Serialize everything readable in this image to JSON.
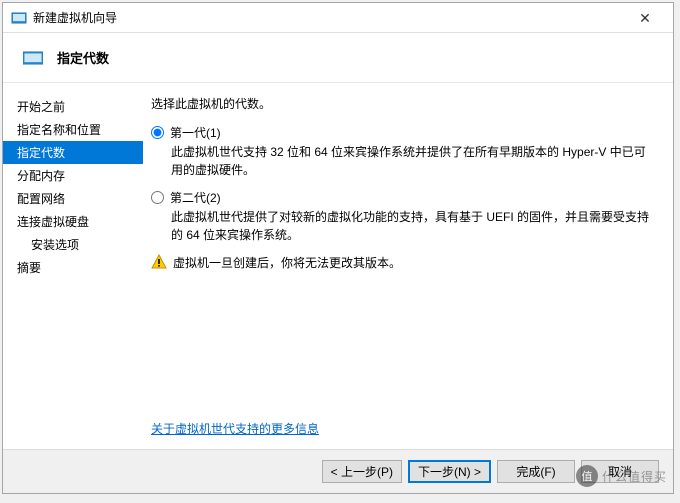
{
  "window": {
    "title": "新建虚拟机向导"
  },
  "header": {
    "title": "指定代数"
  },
  "sidebar": {
    "items": [
      {
        "label": "开始之前"
      },
      {
        "label": "指定名称和位置"
      },
      {
        "label": "指定代数"
      },
      {
        "label": "分配内存"
      },
      {
        "label": "配置网络"
      },
      {
        "label": "连接虚拟硬盘"
      },
      {
        "label": "安装选项"
      },
      {
        "label": "摘要"
      }
    ]
  },
  "content": {
    "description": "选择此虚拟机的代数。",
    "option1": {
      "label": "第一代(1)",
      "desc": "此虚拟机世代支持 32 位和 64 位来宾操作系统并提供了在所有早期版本的 Hyper-V 中已可用的虚拟硬件。"
    },
    "option2": {
      "label": "第二代(2)",
      "desc": "此虚拟机世代提供了对较新的虚拟化功能的支持，具有基于 UEFI 的固件，并且需要受支持的 64 位来宾操作系统。"
    },
    "warning": "虚拟机一旦创建后，你将无法更改其版本。",
    "link": "关于虚拟机世代支持的更多信息"
  },
  "footer": {
    "back": "< 上一步(P)",
    "next": "下一步(N) >",
    "finish": "完成(F)",
    "cancel": "取消"
  },
  "watermark": {
    "logo": "值",
    "text": "什么值得买"
  }
}
